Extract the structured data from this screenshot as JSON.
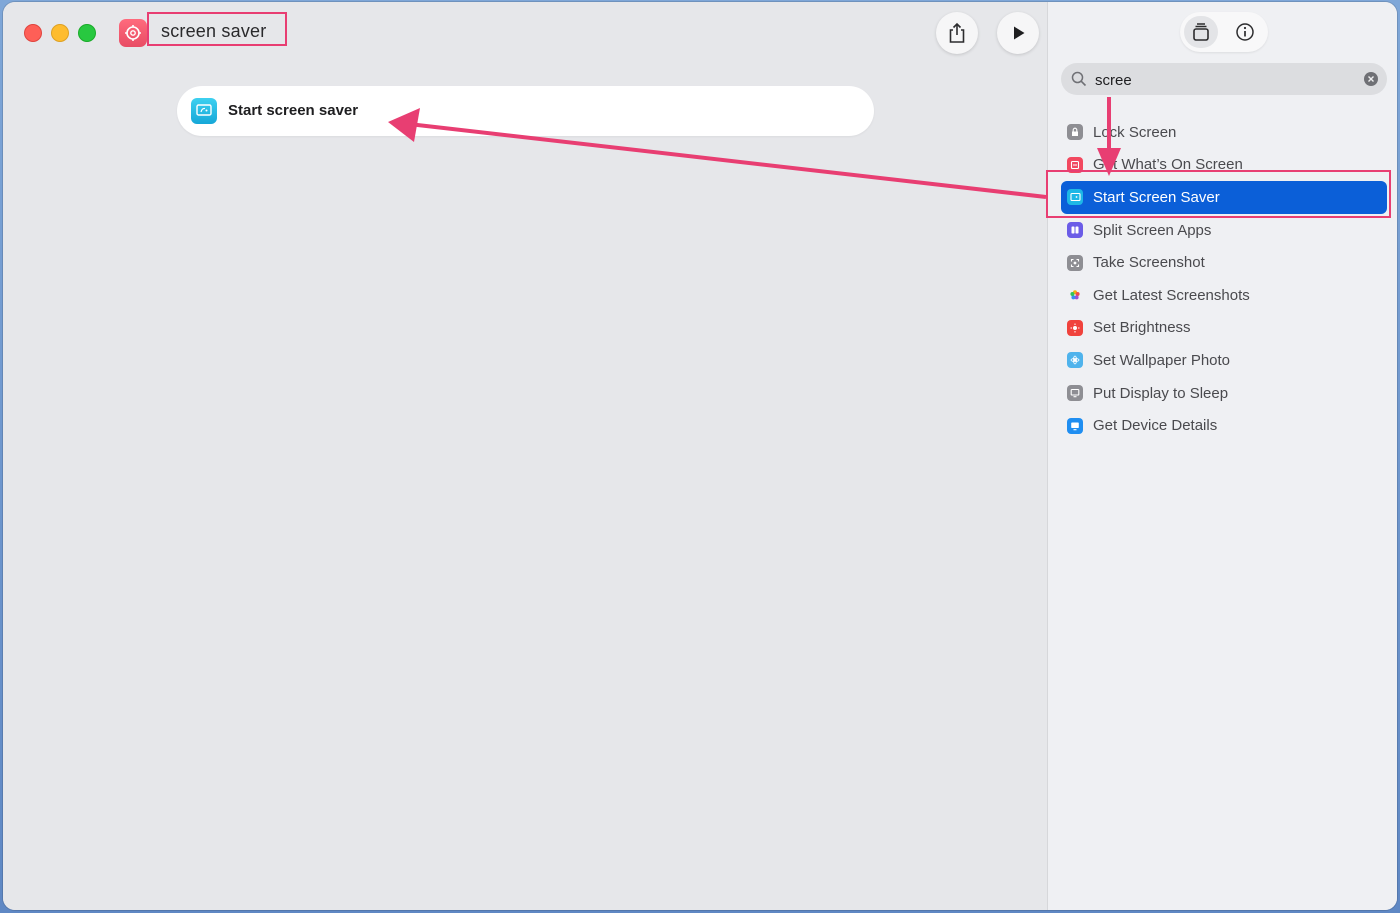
{
  "window": {
    "title": "screen saver",
    "app_icon": "gear-icon"
  },
  "toolbar": {
    "share_icon": "share-icon",
    "run_icon": "play-icon"
  },
  "editor": {
    "action_label": "Start screen saver",
    "action_icon": "screensaver-icon"
  },
  "sidebar": {
    "segment_library_icon": "library-icon",
    "segment_info_icon": "info-icon",
    "search": {
      "value": "scree",
      "icon": "search-icon"
    },
    "results": [
      {
        "label": "Lock Screen",
        "icon": "lock-icon",
        "color": "#8e8e93"
      },
      {
        "label": "Get What’s On Screen",
        "icon": "screen-scan-icon",
        "color": "#f2485f"
      },
      {
        "label": "Start Screen Saver",
        "icon": "screensaver-icon",
        "color": "#1eb7e6",
        "selected": true
      },
      {
        "label": "Split Screen Apps",
        "icon": "split-icon",
        "color": "#6b5ce7"
      },
      {
        "label": "Take Screenshot",
        "icon": "screenshot-icon",
        "color": "#8e8e93"
      },
      {
        "label": "Get Latest Screenshots",
        "icon": "photos-icon",
        "color": "#f39c12"
      },
      {
        "label": "Set Brightness",
        "icon": "brightness-icon",
        "color": "#f0423c"
      },
      {
        "label": "Set Wallpaper Photo",
        "icon": "wallpaper-icon",
        "color": "#4fb3ec"
      },
      {
        "label": "Put Display to Sleep",
        "icon": "display-icon",
        "color": "#8e8e93"
      },
      {
        "label": "Get Device Details",
        "icon": "device-icon",
        "color": "#1f8ef1"
      }
    ]
  },
  "accent_color": "#0b5fd8",
  "annotation_color": "#e83e72"
}
